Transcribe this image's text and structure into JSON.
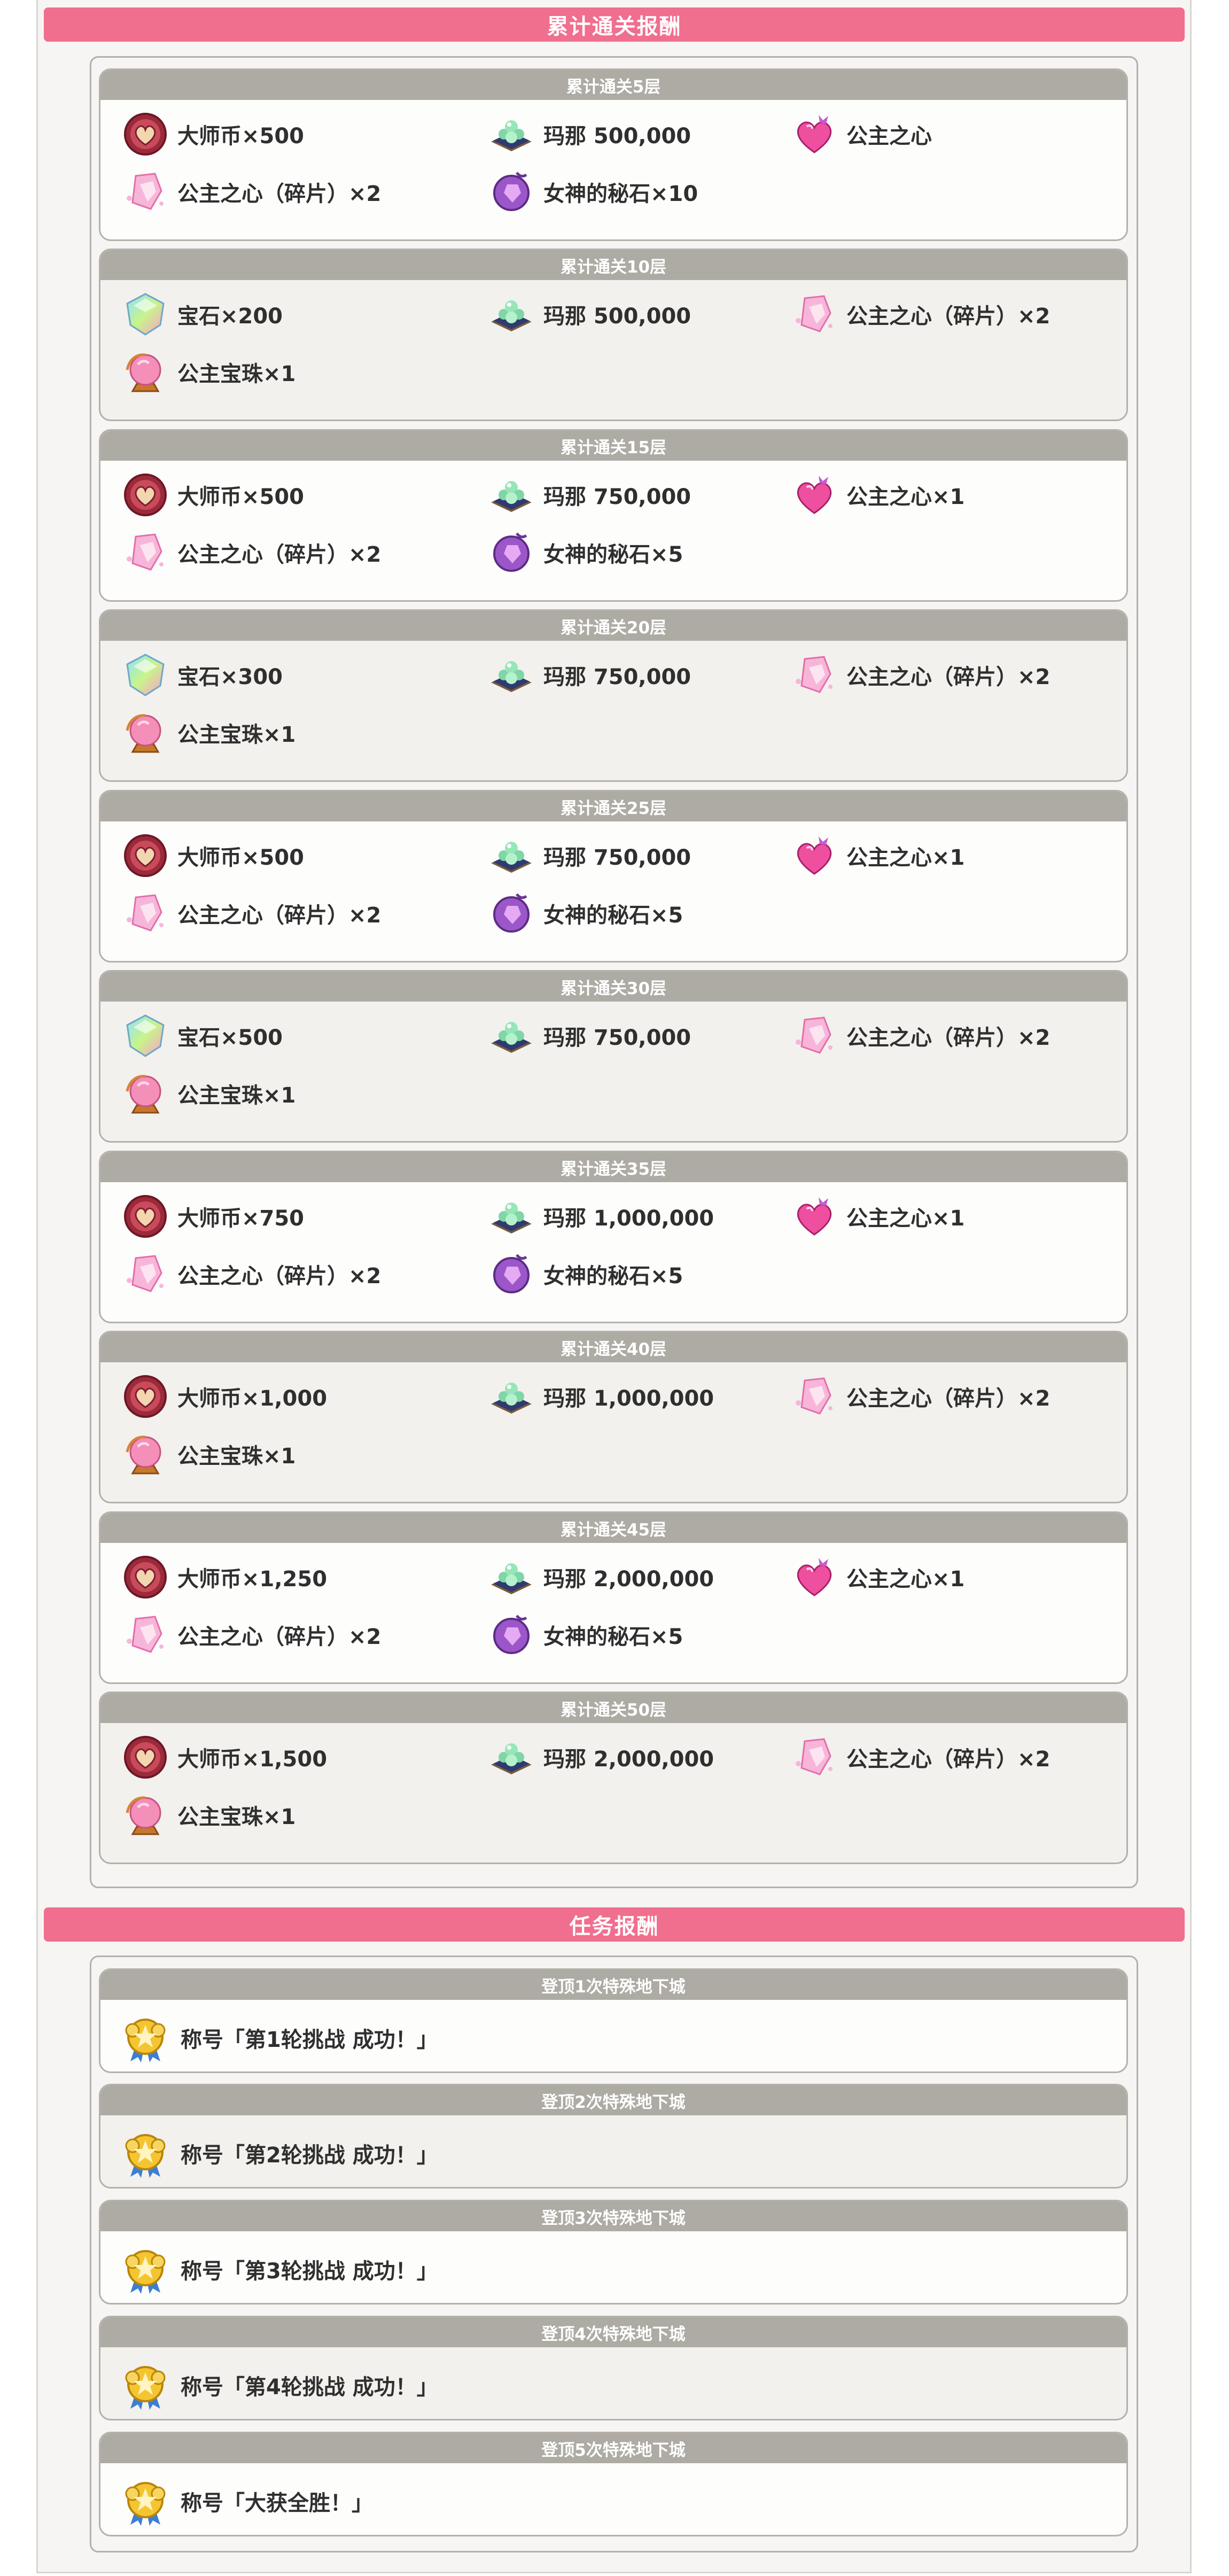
{
  "sections": {
    "cumulative_title": "累计通关报酬",
    "mission_title": "任务报酬"
  },
  "cumulative": [
    {
      "title": "累计通关5层",
      "items": [
        {
          "icon": "master-coin-icon",
          "label": "大师币×500"
        },
        {
          "icon": "mana-icon",
          "label": "玛那 500,000"
        },
        {
          "icon": "princess-heart-icon",
          "label": "公主之心"
        },
        {
          "icon": "princess-heart-fragment-icon",
          "label": "公主之心（碎片）×2"
        },
        {
          "icon": "goddess-stone-icon",
          "label": "女神的秘石×10"
        }
      ]
    },
    {
      "title": "累计通关10层",
      "items": [
        {
          "icon": "jewel-icon",
          "label": "宝石×200"
        },
        {
          "icon": "mana-icon",
          "label": "玛那 500,000"
        },
        {
          "icon": "princess-heart-fragment-icon",
          "label": "公主之心（碎片）×2"
        },
        {
          "icon": "princess-orb-icon",
          "label": "公主宝珠×1"
        }
      ]
    },
    {
      "title": "累计通关15层",
      "items": [
        {
          "icon": "master-coin-icon",
          "label": "大师币×500"
        },
        {
          "icon": "mana-icon",
          "label": "玛那 750,000"
        },
        {
          "icon": "princess-heart-icon",
          "label": "公主之心×1"
        },
        {
          "icon": "princess-heart-fragment-icon",
          "label": "公主之心（碎片）×2"
        },
        {
          "icon": "goddess-stone-icon",
          "label": "女神的秘石×5"
        }
      ]
    },
    {
      "title": "累计通关20层",
      "items": [
        {
          "icon": "jewel-icon",
          "label": "宝石×300"
        },
        {
          "icon": "mana-icon",
          "label": "玛那 750,000"
        },
        {
          "icon": "princess-heart-fragment-icon",
          "label": "公主之心（碎片）×2"
        },
        {
          "icon": "princess-orb-icon",
          "label": "公主宝珠×1"
        }
      ]
    },
    {
      "title": "累计通关25层",
      "items": [
        {
          "icon": "master-coin-icon",
          "label": "大师币×500"
        },
        {
          "icon": "mana-icon",
          "label": "玛那 750,000"
        },
        {
          "icon": "princess-heart-icon",
          "label": "公主之心×1"
        },
        {
          "icon": "princess-heart-fragment-icon",
          "label": "公主之心（碎片）×2"
        },
        {
          "icon": "goddess-stone-icon",
          "label": "女神的秘石×5"
        }
      ]
    },
    {
      "title": "累计通关30层",
      "items": [
        {
          "icon": "jewel-icon",
          "label": "宝石×500"
        },
        {
          "icon": "mana-icon",
          "label": "玛那 750,000"
        },
        {
          "icon": "princess-heart-fragment-icon",
          "label": "公主之心（碎片）×2"
        },
        {
          "icon": "princess-orb-icon",
          "label": "公主宝珠×1"
        }
      ]
    },
    {
      "title": "累计通关35层",
      "items": [
        {
          "icon": "master-coin-icon",
          "label": "大师币×750"
        },
        {
          "icon": "mana-icon",
          "label": "玛那 1,000,000"
        },
        {
          "icon": "princess-heart-icon",
          "label": "公主之心×1"
        },
        {
          "icon": "princess-heart-fragment-icon",
          "label": "公主之心（碎片）×2"
        },
        {
          "icon": "goddess-stone-icon",
          "label": "女神的秘石×5"
        }
      ]
    },
    {
      "title": "累计通关40层",
      "items": [
        {
          "icon": "master-coin-icon",
          "label": "大师币×1,000"
        },
        {
          "icon": "mana-icon",
          "label": "玛那 1,000,000"
        },
        {
          "icon": "princess-heart-fragment-icon",
          "label": "公主之心（碎片）×2"
        },
        {
          "icon": "princess-orb-icon",
          "label": "公主宝珠×1"
        }
      ]
    },
    {
      "title": "累计通关45层",
      "items": [
        {
          "icon": "master-coin-icon",
          "label": "大师币×1,250"
        },
        {
          "icon": "mana-icon",
          "label": "玛那 2,000,000"
        },
        {
          "icon": "princess-heart-icon",
          "label": "公主之心×1"
        },
        {
          "icon": "princess-heart-fragment-icon",
          "label": "公主之心（碎片）×2"
        },
        {
          "icon": "goddess-stone-icon",
          "label": "女神的秘石×5"
        }
      ]
    },
    {
      "title": "累计通关50层",
      "items": [
        {
          "icon": "master-coin-icon",
          "label": "大师币×1,500"
        },
        {
          "icon": "mana-icon",
          "label": "玛那 2,000,000"
        },
        {
          "icon": "princess-heart-fragment-icon",
          "label": "公主之心（碎片）×2"
        },
        {
          "icon": "princess-orb-icon",
          "label": "公主宝珠×1"
        }
      ]
    }
  ],
  "missions": [
    {
      "title": "登顶1次特殊地下城",
      "reward": {
        "icon": "title-medal-icon",
        "label": "称号「第1轮挑战 成功！」"
      }
    },
    {
      "title": "登顶2次特殊地下城",
      "reward": {
        "icon": "title-medal-icon",
        "label": "称号「第2轮挑战 成功！」"
      }
    },
    {
      "title": "登顶3次特殊地下城",
      "reward": {
        "icon": "title-medal-icon",
        "label": "称号「第3轮挑战 成功！」"
      }
    },
    {
      "title": "登顶4次特殊地下城",
      "reward": {
        "icon": "title-medal-icon",
        "label": "称号「第4轮挑战 成功！」"
      }
    },
    {
      "title": "登顶5次特殊地下城",
      "reward": {
        "icon": "title-medal-icon",
        "label": "称号「大获全胜！」"
      }
    }
  ],
  "colors": {
    "section_header": "#f06e8e",
    "card_header": "#aeaba4",
    "card_border": "#b4b1aa"
  }
}
